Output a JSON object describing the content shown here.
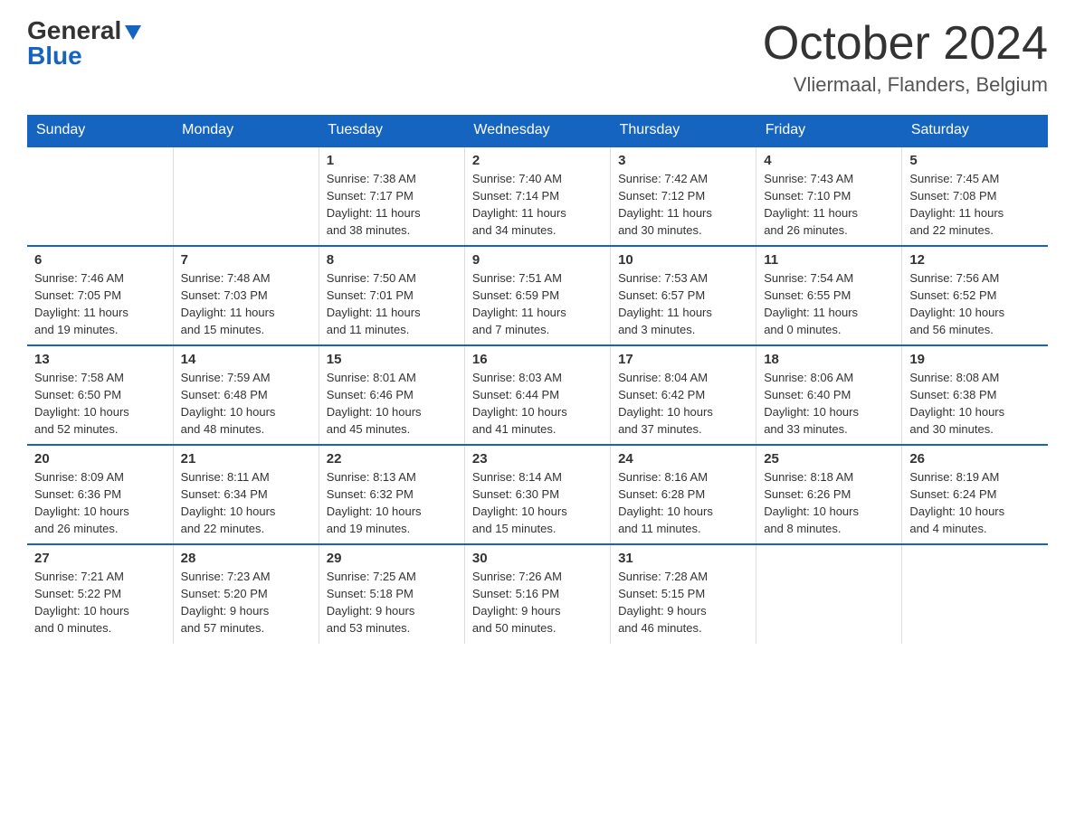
{
  "header": {
    "logo_line1": "General",
    "logo_line2": "Blue",
    "month_title": "October 2024",
    "location": "Vliermaal, Flanders, Belgium"
  },
  "days_of_week": [
    "Sunday",
    "Monday",
    "Tuesday",
    "Wednesday",
    "Thursday",
    "Friday",
    "Saturday"
  ],
  "weeks": [
    [
      {
        "day": "",
        "info": ""
      },
      {
        "day": "",
        "info": ""
      },
      {
        "day": "1",
        "info": "Sunrise: 7:38 AM\nSunset: 7:17 PM\nDaylight: 11 hours\nand 38 minutes."
      },
      {
        "day": "2",
        "info": "Sunrise: 7:40 AM\nSunset: 7:14 PM\nDaylight: 11 hours\nand 34 minutes."
      },
      {
        "day": "3",
        "info": "Sunrise: 7:42 AM\nSunset: 7:12 PM\nDaylight: 11 hours\nand 30 minutes."
      },
      {
        "day": "4",
        "info": "Sunrise: 7:43 AM\nSunset: 7:10 PM\nDaylight: 11 hours\nand 26 minutes."
      },
      {
        "day": "5",
        "info": "Sunrise: 7:45 AM\nSunset: 7:08 PM\nDaylight: 11 hours\nand 22 minutes."
      }
    ],
    [
      {
        "day": "6",
        "info": "Sunrise: 7:46 AM\nSunset: 7:05 PM\nDaylight: 11 hours\nand 19 minutes."
      },
      {
        "day": "7",
        "info": "Sunrise: 7:48 AM\nSunset: 7:03 PM\nDaylight: 11 hours\nand 15 minutes."
      },
      {
        "day": "8",
        "info": "Sunrise: 7:50 AM\nSunset: 7:01 PM\nDaylight: 11 hours\nand 11 minutes."
      },
      {
        "day": "9",
        "info": "Sunrise: 7:51 AM\nSunset: 6:59 PM\nDaylight: 11 hours\nand 7 minutes."
      },
      {
        "day": "10",
        "info": "Sunrise: 7:53 AM\nSunset: 6:57 PM\nDaylight: 11 hours\nand 3 minutes."
      },
      {
        "day": "11",
        "info": "Sunrise: 7:54 AM\nSunset: 6:55 PM\nDaylight: 11 hours\nand 0 minutes."
      },
      {
        "day": "12",
        "info": "Sunrise: 7:56 AM\nSunset: 6:52 PM\nDaylight: 10 hours\nand 56 minutes."
      }
    ],
    [
      {
        "day": "13",
        "info": "Sunrise: 7:58 AM\nSunset: 6:50 PM\nDaylight: 10 hours\nand 52 minutes."
      },
      {
        "day": "14",
        "info": "Sunrise: 7:59 AM\nSunset: 6:48 PM\nDaylight: 10 hours\nand 48 minutes."
      },
      {
        "day": "15",
        "info": "Sunrise: 8:01 AM\nSunset: 6:46 PM\nDaylight: 10 hours\nand 45 minutes."
      },
      {
        "day": "16",
        "info": "Sunrise: 8:03 AM\nSunset: 6:44 PM\nDaylight: 10 hours\nand 41 minutes."
      },
      {
        "day": "17",
        "info": "Sunrise: 8:04 AM\nSunset: 6:42 PM\nDaylight: 10 hours\nand 37 minutes."
      },
      {
        "day": "18",
        "info": "Sunrise: 8:06 AM\nSunset: 6:40 PM\nDaylight: 10 hours\nand 33 minutes."
      },
      {
        "day": "19",
        "info": "Sunrise: 8:08 AM\nSunset: 6:38 PM\nDaylight: 10 hours\nand 30 minutes."
      }
    ],
    [
      {
        "day": "20",
        "info": "Sunrise: 8:09 AM\nSunset: 6:36 PM\nDaylight: 10 hours\nand 26 minutes."
      },
      {
        "day": "21",
        "info": "Sunrise: 8:11 AM\nSunset: 6:34 PM\nDaylight: 10 hours\nand 22 minutes."
      },
      {
        "day": "22",
        "info": "Sunrise: 8:13 AM\nSunset: 6:32 PM\nDaylight: 10 hours\nand 19 minutes."
      },
      {
        "day": "23",
        "info": "Sunrise: 8:14 AM\nSunset: 6:30 PM\nDaylight: 10 hours\nand 15 minutes."
      },
      {
        "day": "24",
        "info": "Sunrise: 8:16 AM\nSunset: 6:28 PM\nDaylight: 10 hours\nand 11 minutes."
      },
      {
        "day": "25",
        "info": "Sunrise: 8:18 AM\nSunset: 6:26 PM\nDaylight: 10 hours\nand 8 minutes."
      },
      {
        "day": "26",
        "info": "Sunrise: 8:19 AM\nSunset: 6:24 PM\nDaylight: 10 hours\nand 4 minutes."
      }
    ],
    [
      {
        "day": "27",
        "info": "Sunrise: 7:21 AM\nSunset: 5:22 PM\nDaylight: 10 hours\nand 0 minutes."
      },
      {
        "day": "28",
        "info": "Sunrise: 7:23 AM\nSunset: 5:20 PM\nDaylight: 9 hours\nand 57 minutes."
      },
      {
        "day": "29",
        "info": "Sunrise: 7:25 AM\nSunset: 5:18 PM\nDaylight: 9 hours\nand 53 minutes."
      },
      {
        "day": "30",
        "info": "Sunrise: 7:26 AM\nSunset: 5:16 PM\nDaylight: 9 hours\nand 50 minutes."
      },
      {
        "day": "31",
        "info": "Sunrise: 7:28 AM\nSunset: 5:15 PM\nDaylight: 9 hours\nand 46 minutes."
      },
      {
        "day": "",
        "info": ""
      },
      {
        "day": "",
        "info": ""
      }
    ]
  ]
}
